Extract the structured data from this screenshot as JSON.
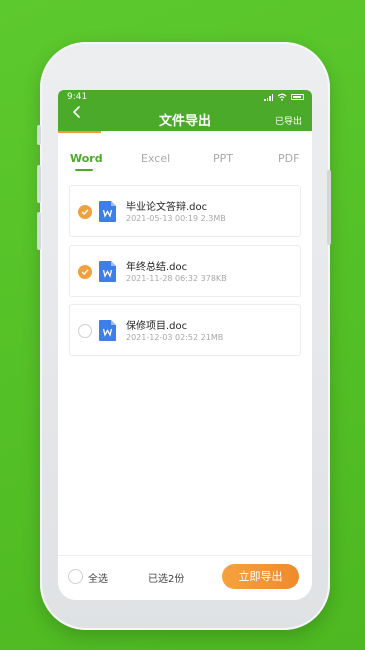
{
  "status_bar": {
    "time": "9:41"
  },
  "header": {
    "title": "文件导出",
    "exported_link": "已导出"
  },
  "tabs": [
    {
      "label": "Word",
      "active": true
    },
    {
      "label": "Excel",
      "active": false
    },
    {
      "label": "PPT",
      "active": false
    },
    {
      "label": "PDF",
      "active": false
    }
  ],
  "files": [
    {
      "name": "毕业论文答辩.doc",
      "meta": "2021-05-13  00:19  2.3MB",
      "selected": true,
      "icon": "word-doc-icon"
    },
    {
      "name": "年终总结.doc",
      "meta": "2021-11-28  06:32  378KB",
      "selected": true,
      "icon": "word-doc-icon"
    },
    {
      "name": "保修项目.doc",
      "meta": "2021-12-03  02:52  21MB",
      "selected": false,
      "icon": "word-doc-icon"
    }
  ],
  "footer": {
    "select_all_label": "全选",
    "selected_count": "已选2份",
    "export_button": "立即导出"
  },
  "colors": {
    "brand_green": "#4caa2a",
    "accent_orange": "#f09a3c",
    "doc_blue": "#3d7ee8"
  }
}
